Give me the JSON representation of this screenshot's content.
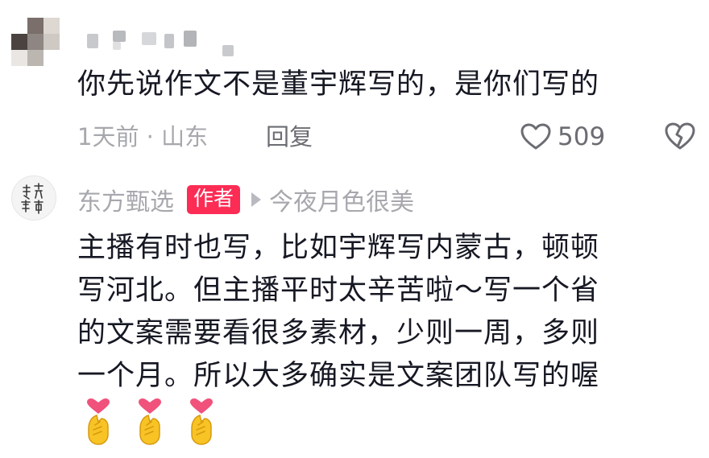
{
  "comment": {
    "text": "你先说作文不是董宇辉写的，是你们写的",
    "time_location": "1天前 · 山东",
    "reply_label": "回复",
    "like_count": "509",
    "like_icon": "heart-outline-icon",
    "dislike_icon": "broken-heart-icon"
  },
  "reply": {
    "author_name": "东方甄选",
    "author_badge": "作者",
    "reply_to": "今夜月色很美",
    "lines": [
      "主播有时也写，比如宇辉写内蒙古，顿顿",
      "写河北。但主播平时太辛苦啦～写一个省",
      "的文案需要看很多素材，少则一周，多则",
      "一个月。所以大多确实是文案团队写的喔"
    ],
    "emojis": [
      "finger-heart-emoji",
      "finger-heart-emoji",
      "finger-heart-emoji"
    ]
  },
  "colors": {
    "text_primary": "#161823",
    "text_secondary": "#a7a8ad",
    "badge": "#fc2c55",
    "emoji_heart": "#f0527c",
    "emoji_hand": "#f7c325"
  }
}
